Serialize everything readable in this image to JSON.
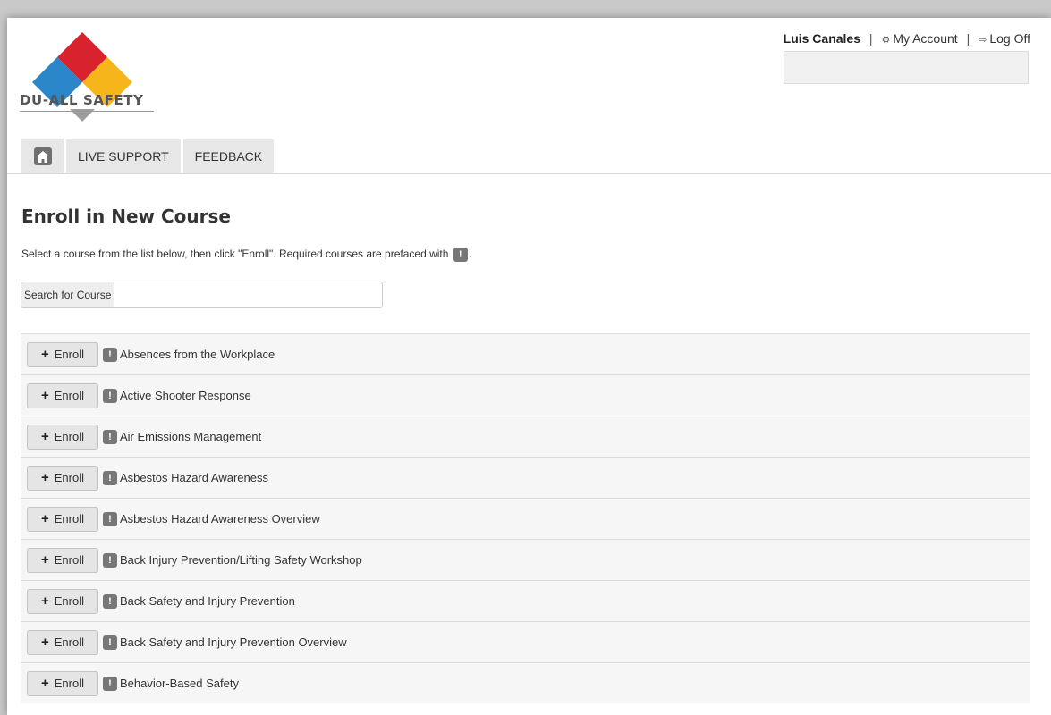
{
  "brand": {
    "logo_text": "DU-ALL SAFETY",
    "colors": {
      "red": "#d8232f",
      "blue": "#2b86c9",
      "yellow": "#f6b51b",
      "gray": "#9d9d9d"
    }
  },
  "user": {
    "name": "Luis Canales",
    "separator": "|",
    "my_account_label": "My Account",
    "my_account_icon": "gears-icon",
    "log_off_label": "Log Off",
    "log_off_icon": "sign-out-icon"
  },
  "nav": {
    "home_icon": "home-icon",
    "tabs": [
      {
        "label": "LIVE SUPPORT"
      },
      {
        "label": "FEEDBACK"
      }
    ]
  },
  "main": {
    "title": "Enroll in New Course",
    "instruction_before": "Select a course from the list below, then click \"Enroll\". Required courses are prefaced with ",
    "instruction_after": ".",
    "required_badge": "!",
    "search_label": "Search for Course",
    "search_value": "",
    "enroll_label": "Enroll",
    "courses": [
      "Absences from the Workplace",
      "Active Shooter Response",
      "Air Emissions Management",
      "Asbestos Hazard Awareness",
      "Asbestos Hazard Awareness Overview",
      "Back Injury Prevention/Lifting Safety Workshop",
      "Back Safety and Injury Prevention",
      "Back Safety and Injury Prevention Overview",
      "Behavior-Based Safety"
    ]
  }
}
